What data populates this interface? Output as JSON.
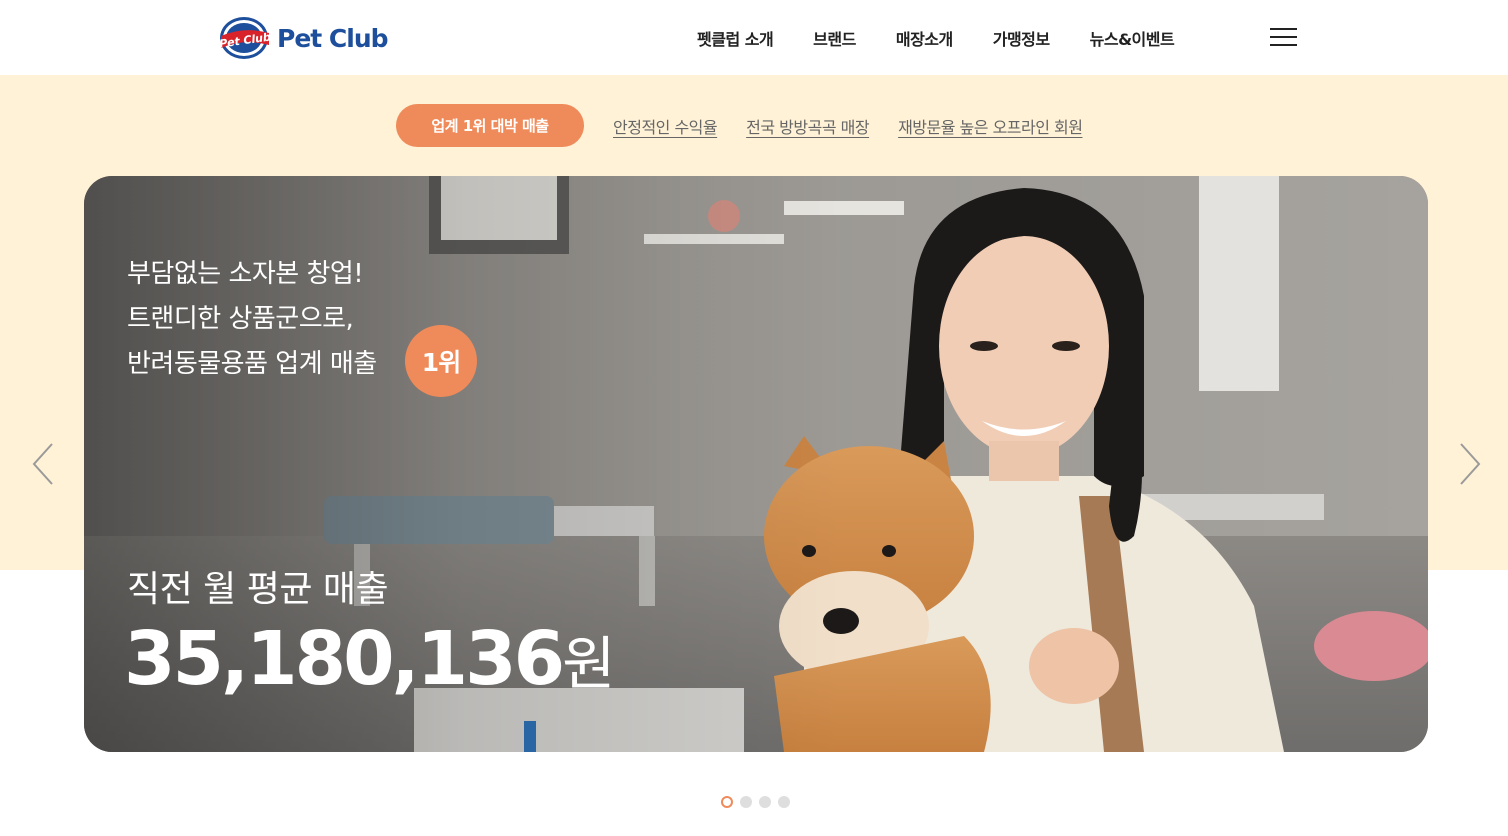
{
  "header": {
    "logo_badge_text": "Pet Club",
    "logo_text": "Pet Club",
    "nav": [
      "펫클럽 소개",
      "브랜드",
      "매장소개",
      "가맹정보",
      "뉴스&이벤트"
    ],
    "menu_icon": "hamburger-icon"
  },
  "tabs": {
    "active": "업계 1위 대박 매출",
    "items": [
      "안정적인 수익율",
      "전국 방방곡곡 매장",
      "재방문율 높은 오프라인 회원"
    ]
  },
  "hero": {
    "copy_lines": [
      "부담없는 소자본 창업!",
      "트랜디한 상품군으로,",
      "반려동물용품 업계 매출"
    ],
    "rank_badge": "1위",
    "sales_caption": "직전 월 평균 매출",
    "sales_number": "35,180,136",
    "sales_unit": "원",
    "prev_icon": "chevron-left-icon",
    "next_icon": "chevron-right-icon"
  },
  "pagination": {
    "count": 4,
    "active_index": 0
  },
  "colors": {
    "accent": "#ef8b5a",
    "band": "#fff2d7",
    "brand_blue": "#1d4f9c",
    "logo_red": "#d8232a"
  }
}
